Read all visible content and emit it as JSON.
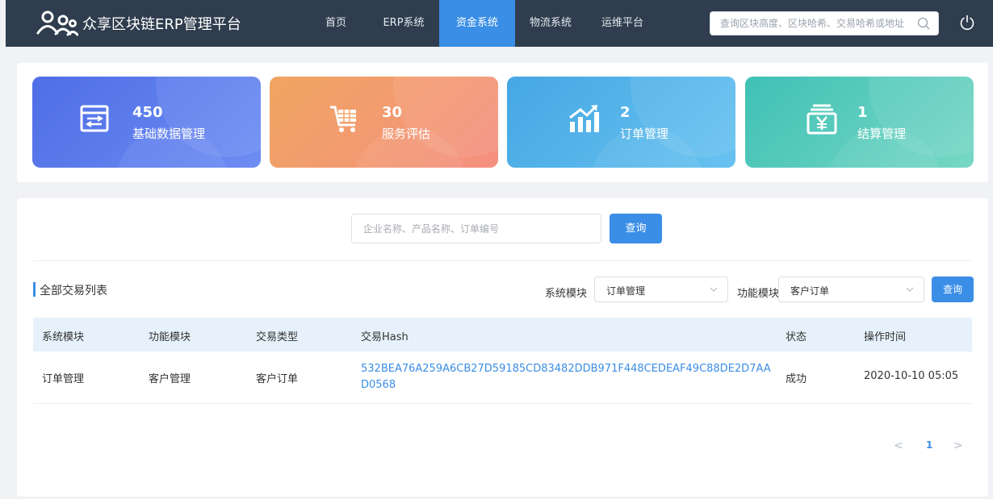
{
  "header": {
    "title": "众享区块链ERP管理平台",
    "nav": [
      "首页",
      "ERP系统",
      "资金系统",
      "物流系统",
      "运维平台"
    ],
    "active_nav": "资金系统",
    "search_placeholder": "查询区块高度、区块哈希、交易哈希或地址"
  },
  "stats": [
    {
      "value": "450",
      "label": "基础数据管理",
      "icon": "sliders-icon",
      "colors": [
        "#4e6ee6",
        "#6d8df3"
      ]
    },
    {
      "value": "30",
      "label": "服务评估",
      "icon": "cart-icon",
      "colors": [
        "#f0a661",
        "#f58f80"
      ]
    },
    {
      "value": "2",
      "label": "订单管理",
      "icon": "chart-up-icon",
      "colors": [
        "#45a7e3",
        "#67c2f0"
      ]
    },
    {
      "value": "1",
      "label": "结算管理",
      "icon": "yen-icon",
      "colors": [
        "#3fc1b5",
        "#77d7c5"
      ]
    }
  ],
  "main": {
    "search_placeholder": "企业名称、产品名称、订单编号",
    "search_button": "查询",
    "section_title": "全部交易列表",
    "filters": {
      "system_label": "系统模块",
      "system_value": "订单管理",
      "function_label": "功能模块",
      "function_value": "客户订单",
      "button": "查询"
    },
    "table": {
      "columns": [
        "系统模块",
        "功能模块",
        "交易类型",
        "交易Hash",
        "状态",
        "操作时间"
      ],
      "rows": [
        [
          "订单管理",
          "客户管理",
          "客户订单",
          "532BEA76A259A6CB27D59185CD83482DDB971F448CEDEAF49C88DE2D7AAD0568",
          "成功",
          "2020-10-10 05:05"
        ]
      ]
    },
    "pagination": {
      "prev": "<",
      "current": "1",
      "next": ">"
    }
  }
}
